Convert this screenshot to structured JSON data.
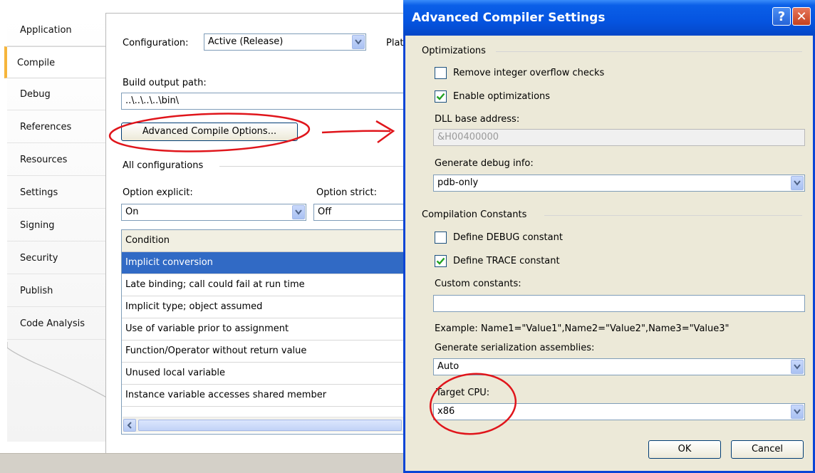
{
  "tabs": [
    {
      "label": "Application",
      "active": false
    },
    {
      "label": "Compile",
      "active": true
    },
    {
      "label": "Debug",
      "active": false
    },
    {
      "label": "References",
      "active": false
    },
    {
      "label": "Resources",
      "active": false
    },
    {
      "label": "Settings",
      "active": false
    },
    {
      "label": "Signing",
      "active": false
    },
    {
      "label": "Security",
      "active": false
    },
    {
      "label": "Publish",
      "active": false
    },
    {
      "label": "Code Analysis",
      "active": false
    }
  ],
  "compile": {
    "configuration_label": "Configuration:",
    "configuration_value": "Active (Release)",
    "platform_label_partial": "Plat",
    "build_output_label": "Build output path:",
    "build_output_value": "..\\..\\..\\..\\bin\\",
    "advanced_button": "Advanced Compile Options...",
    "all_config_label": "All configurations",
    "option_explicit_label": "Option explicit:",
    "option_explicit_value": "On",
    "option_strict_label": "Option strict:",
    "option_strict_value": "Off",
    "grid": {
      "header": "Condition",
      "rows": [
        "Implicit conversion",
        "Late binding; call could fail at run time",
        "Implicit type; object assumed",
        "Use of variable prior to assignment",
        "Function/Operator without return value",
        "Unused local variable",
        "Instance variable accesses shared member"
      ],
      "selected_index": 0
    }
  },
  "dialog": {
    "title": "Advanced Compiler Settings",
    "help_glyph": "?",
    "close_glyph": "✕",
    "optimizations_group": "Optimizations",
    "remove_overflow_label": "Remove integer overflow checks",
    "remove_overflow_checked": false,
    "enable_opt_label": "Enable optimizations",
    "enable_opt_checked": true,
    "dll_base_label": "DLL base address:",
    "dll_base_value": "&H00400000",
    "debug_info_label": "Generate debug info:",
    "debug_info_value": "pdb-only",
    "constants_group": "Compilation Constants",
    "define_debug_label": "Define DEBUG constant",
    "define_debug_checked": false,
    "define_trace_label": "Define TRACE constant",
    "define_trace_checked": true,
    "custom_constants_label": "Custom constants:",
    "custom_constants_value": "",
    "example_text": "Example: Name1=\"Value1\",Name2=\"Value2\",Name3=\"Value3\"",
    "serialization_label": "Generate serialization assemblies:",
    "serialization_value": "Auto",
    "target_cpu_label": "Target CPU:",
    "target_cpu_value": "x86",
    "ok_label": "OK",
    "cancel_label": "Cancel"
  },
  "colors": {
    "selection": "#316ac5",
    "titlebar": "#0554e0",
    "annotation": "#e0151b",
    "active_tab_accent": "#f6b53b"
  }
}
